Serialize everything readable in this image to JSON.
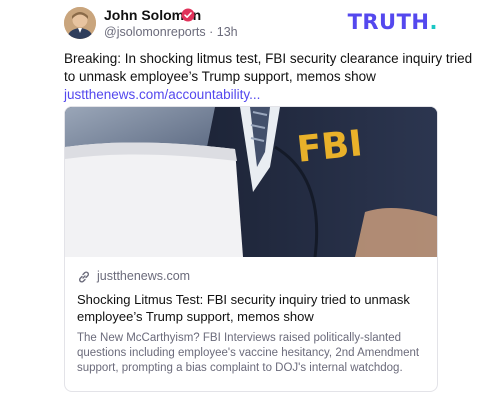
{
  "post": {
    "author_name": "John Solomon",
    "author_handle": "@jsolomonreports",
    "separator": "·",
    "timestamp": "13h",
    "text": "Breaking: In shocking litmus test, FBI security clearance inquiry tried to unmask employee’s Trump support, memos show",
    "link_text": "justthenews.com/accountability..."
  },
  "brand": {
    "logo_text": "TRUTH",
    "logo_dot": ".",
    "accent_color": "#5448ee",
    "dot_color": "#1ac7c4"
  },
  "card": {
    "image_text": "FBI",
    "domain": "justthenews.com",
    "title": "Shocking Litmus Test: FBI security inquiry tried to unmask employee’s Trump support, memos show",
    "description": "The New McCarthyism? FBI Interviews raised politically-slanted questions including employee's vaccine hesitancy, 2nd Amendment support, prompting a bias complaint to DOJ's internal watchdog."
  },
  "icons": {
    "verified": "verified-badge-icon",
    "link": "link-icon"
  }
}
